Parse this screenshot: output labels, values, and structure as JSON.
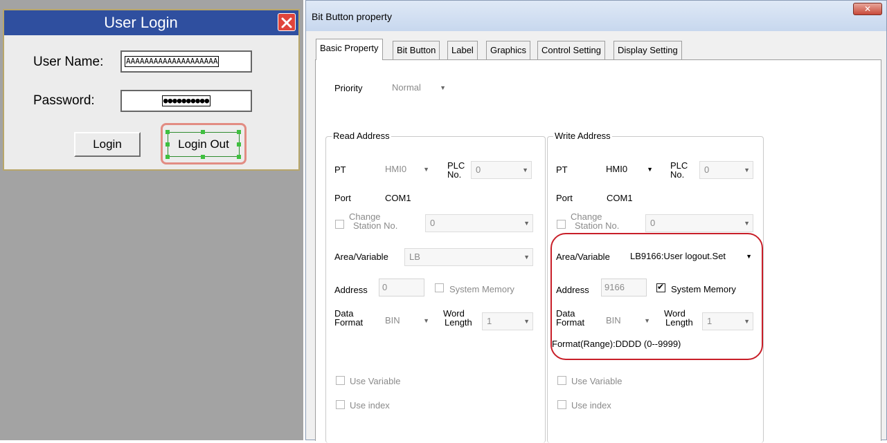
{
  "hmi": {
    "title": "User Login",
    "user_name_label": "User Name:",
    "user_name_value": "AAAAAAAAAAAAAAAAAAAA",
    "password_label": "Password:",
    "password_value": "●●●●●●●●●●",
    "login_button": "Login",
    "logout_button": "Login Out"
  },
  "dialog": {
    "title": "Bit Button property",
    "close_label": "✕",
    "tabs": [
      {
        "label": "Basic Property"
      },
      {
        "label": "Bit Button"
      },
      {
        "label": "Label"
      },
      {
        "label": "Graphics"
      },
      {
        "label": "Control Setting"
      },
      {
        "label": "Display Setting"
      }
    ],
    "priority_label": "Priority",
    "priority_value": "Normal",
    "read": {
      "group_title": "Read Address",
      "pt_label": "PT",
      "pt_value": "HMI0",
      "plc_label_1": "PLC",
      "plc_label_2": "No.",
      "plc_value": "0",
      "port_label": "Port",
      "port_value": "COM1",
      "change_station_1": "Change",
      "change_station_2": "Station No.",
      "station_value": "0",
      "area_label": "Area/Variable",
      "area_value": "LB",
      "address_label": "Address",
      "address_value": "0",
      "system_memory_label": "System Memory",
      "data_format_1": "Data",
      "data_format_2": "Format",
      "data_format_value": "BIN",
      "word_length_1": "Word",
      "word_length_2": "Length",
      "word_length_value": "1",
      "use_variable_label": "Use Variable",
      "use_index_label": "Use index"
    },
    "write": {
      "group_title": "Write Address",
      "pt_label": "PT",
      "pt_value": "HMI0",
      "plc_label_1": "PLC",
      "plc_label_2": "No.",
      "plc_value": "0",
      "port_label": "Port",
      "port_value": "COM1",
      "change_station_1": "Change",
      "change_station_2": "Station No.",
      "station_value": "0",
      "area_label": "Area/Variable",
      "area_value": "LB9166:User logout.Set",
      "address_label": "Address",
      "address_value": "9166",
      "system_memory_label": "System Memory",
      "system_memory_checked": true,
      "data_format_1": "Data",
      "data_format_2": "Format",
      "data_format_value": "BIN",
      "word_length_1": "Word",
      "word_length_2": "Length",
      "word_length_value": "1",
      "format_range": "Format(Range):DDDD (0--9999)",
      "use_variable_label": "Use Variable",
      "use_index_label": "Use index"
    }
  }
}
